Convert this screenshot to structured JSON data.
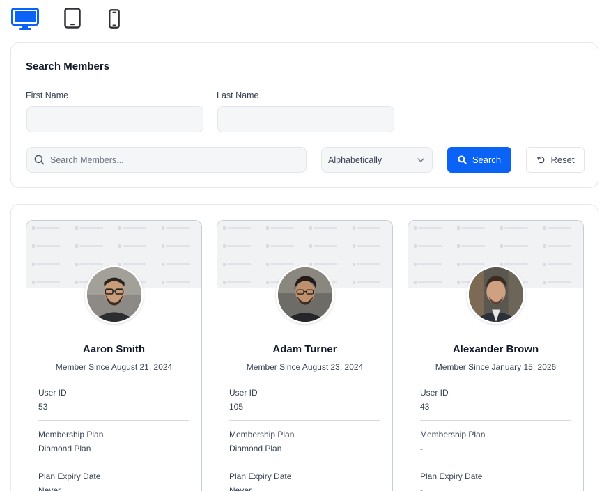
{
  "devices": {
    "desktop_color": "#0b63f6",
    "inactive_color": "#2f3136",
    "icons": [
      "desktop-icon",
      "tablet-icon",
      "phone-icon"
    ]
  },
  "search": {
    "title": "Search Members",
    "first_name_label": "First Name",
    "first_name_value": "",
    "last_name_label": "Last Name",
    "last_name_value": "",
    "query_placeholder": "Search Members...",
    "query_value": "",
    "sort_selected": "Alphabetically",
    "search_button_label": "Search",
    "reset_button_label": "Reset",
    "accent_color": "#0b63f6"
  },
  "members": [
    {
      "name": "Aaron Smith",
      "member_since": "Member Since August 21, 2024",
      "user_id_label": "User ID",
      "user_id": "53",
      "plan_label": "Membership Plan",
      "plan": "Diamond Plan",
      "expiry_label": "Plan Expiry Date",
      "expiry": "Never"
    },
    {
      "name": "Adam Turner",
      "member_since": "Member Since August 23, 2024",
      "user_id_label": "User ID",
      "user_id": "105",
      "plan_label": "Membership Plan",
      "plan": "Diamond Plan",
      "expiry_label": "Plan Expiry Date",
      "expiry": "Never"
    },
    {
      "name": "Alexander Brown",
      "member_since": "Member Since January 15, 2026",
      "user_id_label": "User ID",
      "user_id": "43",
      "plan_label": "Membership Plan",
      "plan": "-",
      "expiry_label": "Plan Expiry Date",
      "expiry": "-"
    }
  ]
}
